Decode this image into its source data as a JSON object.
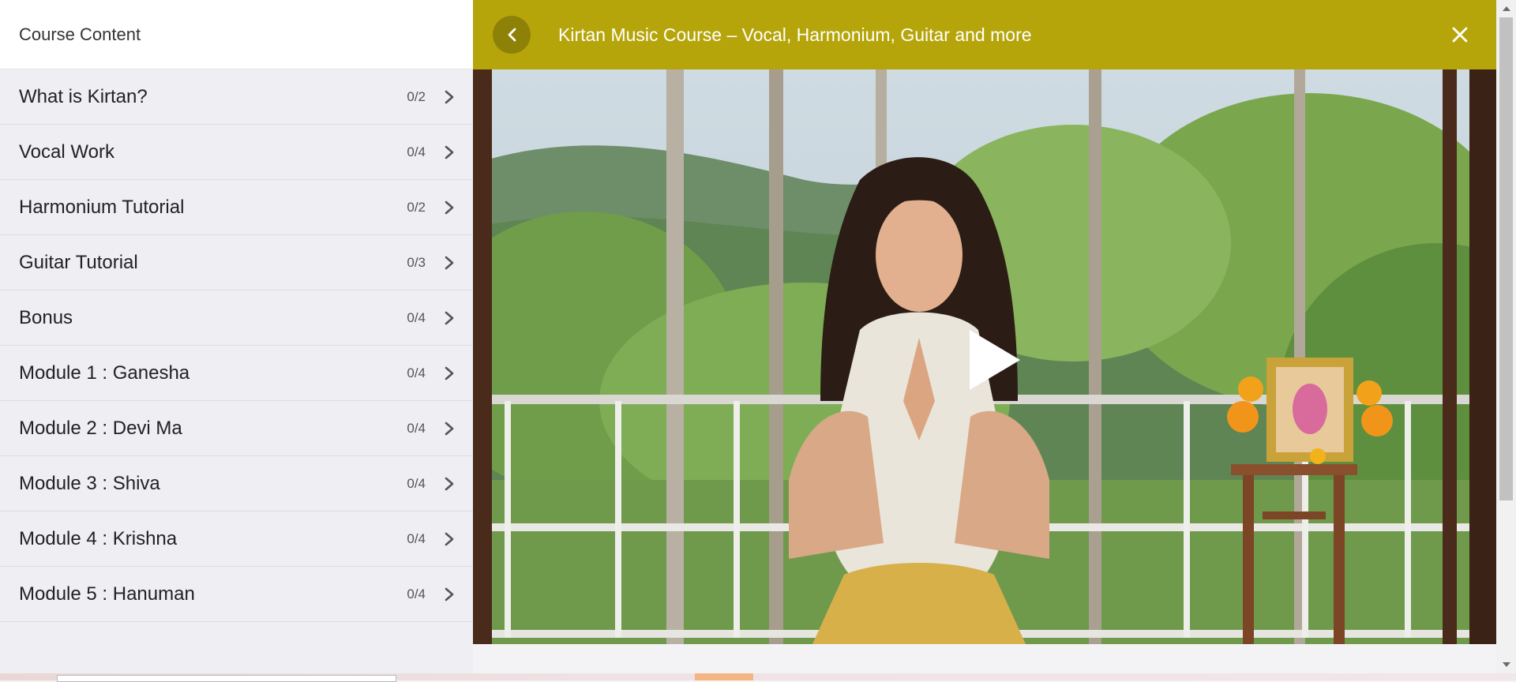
{
  "sidebar": {
    "title": "Course Content",
    "modules": [
      {
        "title": "What is Kirtan?",
        "progress": "0/2"
      },
      {
        "title": "Vocal Work",
        "progress": "0/4"
      },
      {
        "title": "Harmonium Tutorial",
        "progress": "0/2"
      },
      {
        "title": "Guitar Tutorial",
        "progress": "0/3"
      },
      {
        "title": "Bonus",
        "progress": "0/4"
      },
      {
        "title": "Module 1 : Ganesha",
        "progress": "0/4"
      },
      {
        "title": "Module 2 : Devi Ma",
        "progress": "0/4"
      },
      {
        "title": "Module 3 : Shiva",
        "progress": "0/4"
      },
      {
        "title": "Module 4 : Krishna",
        "progress": "0/4"
      },
      {
        "title": "Module 5 : Hanuman",
        "progress": "0/4"
      }
    ]
  },
  "header": {
    "course_title": "Kirtan Music Course – Vocal, Harmonium, Guitar and more",
    "back_icon": "chevron-left-icon",
    "close_icon": "close-icon"
  },
  "video": {
    "play_icon": "play-icon"
  },
  "colors": {
    "header_bg": "#b5a50a",
    "back_button_bg": "#8e8108",
    "sidebar_bg": "#eeeef3"
  }
}
